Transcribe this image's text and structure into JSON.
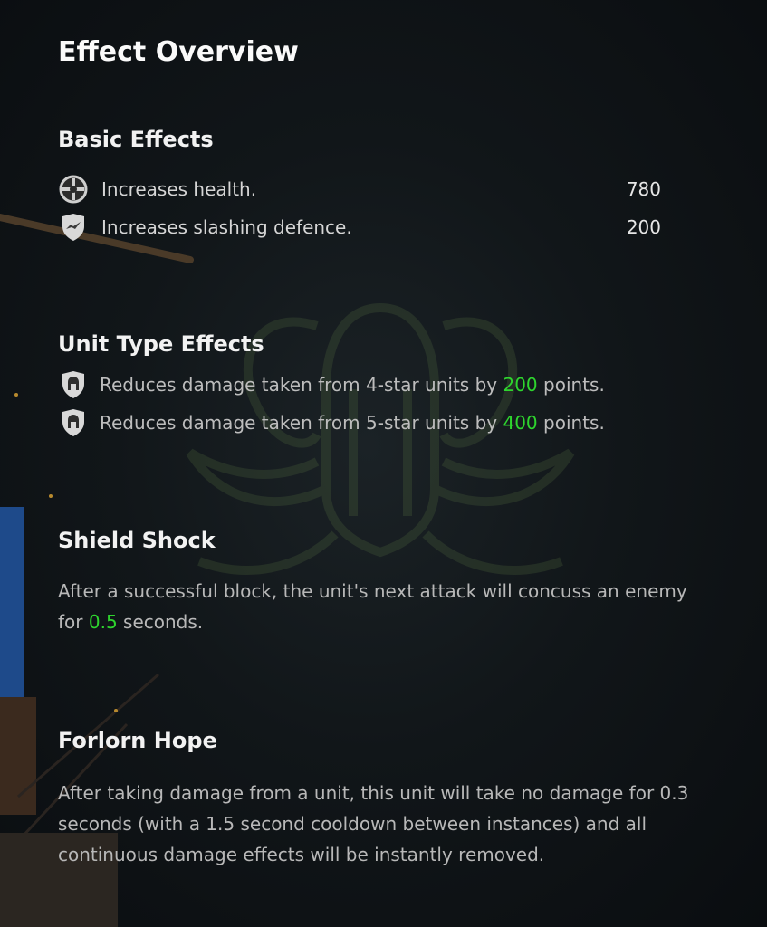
{
  "title": "Effect Overview",
  "basic_effects": {
    "heading": "Basic Effects",
    "items": [
      {
        "icon": "health-crosshair-icon",
        "label": "Increases health.",
        "value": "780"
      },
      {
        "icon": "slashing-defence-shield-icon",
        "label": "Increases slashing defence.",
        "value": "200"
      }
    ]
  },
  "unit_type_effects": {
    "heading": "Unit Type Effects",
    "items": [
      {
        "icon": "helmet-shield-icon",
        "prefix": "Reduces damage taken from 4-star units by ",
        "value": "200",
        "suffix": " points."
      },
      {
        "icon": "helmet-shield-icon",
        "prefix": "Reduces damage taken from 5-star units by ",
        "value": "400",
        "suffix": " points."
      }
    ]
  },
  "shield_shock": {
    "heading": "Shield Shock",
    "text_before": "After a successful block, the unit's next attack will concuss an enemy for ",
    "value": "0.5",
    "text_after": " seconds."
  },
  "forlorn_hope": {
    "heading": "Forlorn Hope",
    "text": "After taking damage from a unit, this unit will take no damage for 0.3 seconds (with a 1.5 second cooldown between instances) and all continuous damage effects will be instantly removed."
  },
  "colors": {
    "highlight": "#2ed52e",
    "background": "#111619"
  }
}
